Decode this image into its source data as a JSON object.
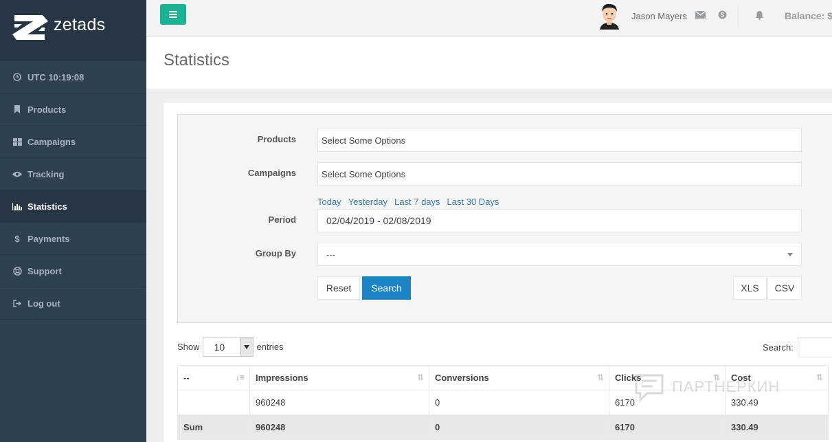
{
  "brand": {
    "name": "zetads"
  },
  "clock": {
    "label": "UTC 10:19:08"
  },
  "sidebar": {
    "items": [
      {
        "label": "Products",
        "icon": "bookmark-icon"
      },
      {
        "label": "Campaigns",
        "icon": "grid-icon"
      },
      {
        "label": "Tracking",
        "icon": "eye-icon"
      },
      {
        "label": "Statistics",
        "icon": "bar-chart-icon",
        "active": true
      },
      {
        "label": "Payments",
        "icon": "dollar-icon"
      },
      {
        "label": "Support",
        "icon": "lifebuoy-icon"
      },
      {
        "label": "Log out",
        "icon": "sign-out-icon"
      }
    ]
  },
  "topbar": {
    "user_name": "Jason Mayers",
    "balance_label": "Balance: $"
  },
  "page": {
    "title": "Statistics"
  },
  "filters": {
    "products_label": "Products",
    "products_placeholder": "Select Some Options",
    "campaigns_label": "Campaigns",
    "campaigns_placeholder": "Select Some Options",
    "quick_links": [
      "Today",
      "Yesterday",
      "Last 7 days",
      "Last 30 Days"
    ],
    "period_label": "Period",
    "period_value": "02/04/2019 - 02/08/2019",
    "group_by_label": "Group By",
    "group_by_value": "---",
    "reset_label": "Reset",
    "search_label": "Search",
    "xls_label": "XLS",
    "csv_label": "CSV"
  },
  "table_controls": {
    "show_label": "Show",
    "entries_value": "10",
    "entries_label": "entries",
    "search_label": "Search:"
  },
  "table": {
    "headers": [
      "--",
      "Impressions",
      "Conversions",
      "Clicks",
      "Cost"
    ],
    "rows": [
      [
        "",
        "960248",
        "0",
        "6170",
        "330.49"
      ]
    ],
    "sum_row": [
      "Sum",
      "960248",
      "0",
      "6170",
      "330.49"
    ]
  },
  "watermark": {
    "text": "ПАРТНЕРКИН"
  },
  "colors": {
    "sidebar_bg": "#2f4050",
    "accent_green": "#1ab394",
    "primary_blue": "#1c84c6",
    "link_blue": "#337ab7"
  }
}
